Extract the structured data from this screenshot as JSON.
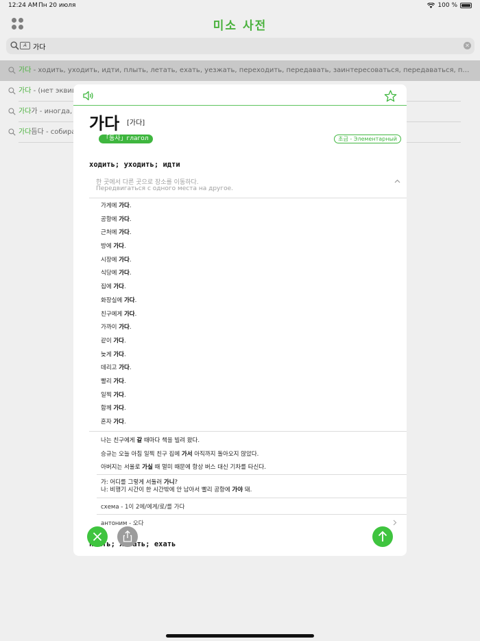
{
  "status_bar": {
    "time": "12:24 AM",
    "date": "Пн 20 июля",
    "battery": "100 %"
  },
  "app": {
    "title": "미소 사전"
  },
  "search": {
    "query": "가다"
  },
  "results": [
    {
      "headword": "가다",
      "rest": " - ходить, уходить, идти, плыть, летать, ехать, уезжать, переходить, передавать, заинтересоваться, передаваться, приходить, до..."
    },
    {
      "headword": "가다",
      "rest": " - (нет эквив"
    },
    {
      "headword": "가다",
      "rest": "가 - иногда, и"
    },
    {
      "headword": "가다",
      "rest": "듬다 - собира"
    }
  ],
  "entry": {
    "word": "가다",
    "pronunciation": "[가다]",
    "pos": "「동사」глагол",
    "level": "초급 - Элементарный",
    "sense_title": "ходить; уходить; идти",
    "definition_ko": "한 곳에서 다른 곳으로 장소를 이동하다.",
    "definition_ru": "Передвигаться с одного места на другое.",
    "collocations": [
      {
        "pre": "가게에 ",
        "bold": "가다",
        "post": "."
      },
      {
        "pre": "공항에 ",
        "bold": "가다",
        "post": "."
      },
      {
        "pre": "근처에 ",
        "bold": "가다",
        "post": "."
      },
      {
        "pre": "방에 ",
        "bold": "가다",
        "post": "."
      },
      {
        "pre": "시장에 ",
        "bold": "가다",
        "post": "."
      },
      {
        "pre": "식당에 ",
        "bold": "가다",
        "post": "."
      },
      {
        "pre": "집에 ",
        "bold": "가다",
        "post": "."
      },
      {
        "pre": "화장실에 ",
        "bold": "가다",
        "post": "."
      },
      {
        "pre": "친구에게 ",
        "bold": "가다",
        "post": "."
      },
      {
        "pre": "가까이 ",
        "bold": "가다",
        "post": "."
      },
      {
        "pre": "같이 ",
        "bold": "가다",
        "post": "."
      },
      {
        "pre": "늦게 ",
        "bold": "가다",
        "post": "."
      },
      {
        "pre": "데리고 ",
        "bold": "가다",
        "post": "."
      },
      {
        "pre": "빨리 ",
        "bold": "가다",
        "post": "."
      },
      {
        "pre": "일찍 ",
        "bold": "가다",
        "post": "."
      },
      {
        "pre": "함께 ",
        "bold": "가다",
        "post": "."
      },
      {
        "pre": "혼자 ",
        "bold": "가다",
        "post": "."
      }
    ],
    "examples": [
      {
        "pre": "나는 친구에게 ",
        "bold": "갈",
        "post": " 때마다 책을 빌려 왔다."
      },
      {
        "pre": "승규는 오늘 아침 일찍 친구 집에 ",
        "bold": "가서",
        "post": " 아직까지 돌아오지 않았다."
      },
      {
        "pre": "아버지는 서울로 ",
        "bold": "가실",
        "post": " 때 멀미 때문에 항상 버스 대신 기차를 타신다."
      }
    ],
    "dialog": [
      {
        "pre": "가: 어디를 그렇게 서둘러 ",
        "bold": "가니",
        "post": "?"
      },
      {
        "pre": "나: 비행기 시간이 한 시간밖에 안 남아서 빨리 공항에 ",
        "bold": "가야",
        "post": " 돼."
      }
    ],
    "schema": "схема - 1이 2에/에게/로/를 가다",
    "antonym": "антоним - 오다",
    "next_sense_title": "плыть; летать; ехать"
  },
  "colors": {
    "accent": "#3fb63f",
    "title_green": "#49b13c",
    "share_gray": "#9c9c9c"
  },
  "icons": {
    "apps": "apps-grid-icon",
    "search": "search-icon",
    "keyboard": "handwriting-icon",
    "clear": "clear-icon",
    "speaker": "speaker-icon",
    "star": "star-icon",
    "collapse": "chevron-up-icon",
    "chevron": "chevron-right-icon",
    "close": "close-icon",
    "share": "share-icon",
    "up": "arrow-up-icon"
  }
}
